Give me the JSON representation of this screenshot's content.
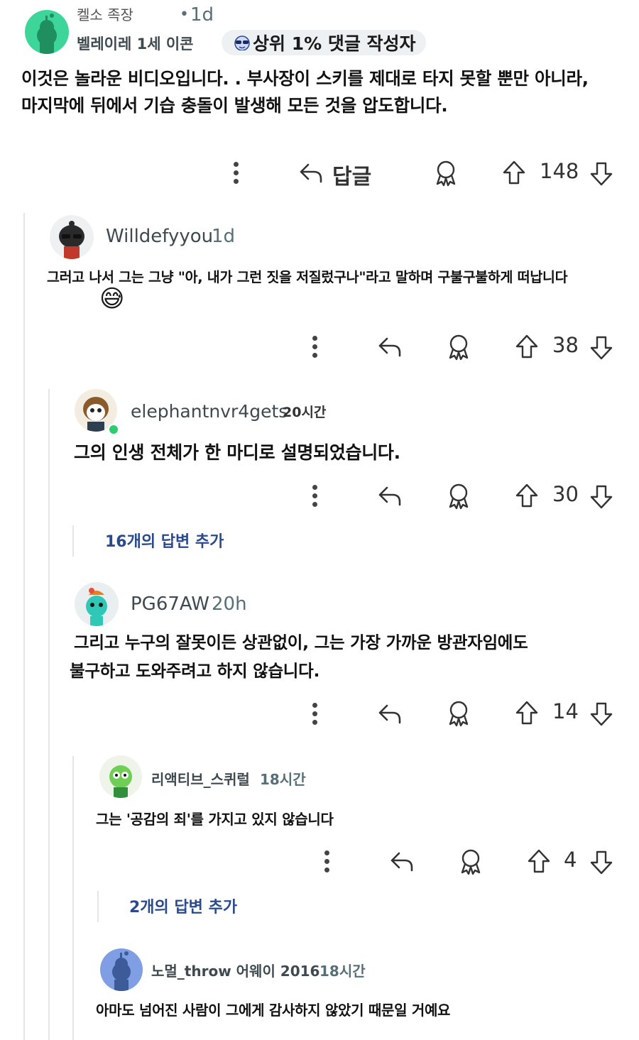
{
  "colors": {
    "accent": "#2b4a8c",
    "online": "#2ecc71",
    "badge_bg": "#eef1f4"
  },
  "comments": [
    {
      "flair": "켈소 족장",
      "time": "1d",
      "username": "벨레이레 1세 이콘",
      "badge": "상위 1% 댓글 작성자",
      "body": [
        "이것은 놀라운 비디오입니다. . 부사장이 스키를 제대로 타지 못할 뿐만 아니라,",
        "마지막에 뒤에서 기습 충돌이 발생해 모든 것을 압도합니다."
      ],
      "reply_label": "답글",
      "score": "148"
    },
    {
      "username": "Willdefyyou",
      "time": "1d",
      "body": [
        "그러고 나서 그는 그냥 \"아, 내가 그런 짓을 저질렀구나\"라고 말하며 구불구불하게 떠납니다"
      ],
      "emoji": "😅",
      "score": "38"
    },
    {
      "username": "elephantnvr4gets",
      "time": "20시간",
      "body": [
        "그의 인생 전체가 한 마디로 설명되었습니다."
      ],
      "score": "30",
      "more_replies": "16개의 답변 추가"
    },
    {
      "username": "PG67AW",
      "time": "20h",
      "body": [
        "그리고 누구의 잘못이든 상관없이, 그는 가장 가까운 방관자임에도",
        "불구하고 도와주려고 하지 않습니다."
      ],
      "score": "14"
    },
    {
      "username": "리액티브_스퀴럴",
      "time": "18시간",
      "body": [
        "그는 '공감의 죄'를 가지고 있지 않습니다"
      ],
      "score": "4",
      "more_replies": "2개의 답변 추가"
    },
    {
      "username": "노멀_throw 어웨이 2016",
      "time": "18시간",
      "body": [
        "아마도 넘어진 사람이 그에게 감사하지 않았기 때문일 거예요"
      ]
    }
  ]
}
